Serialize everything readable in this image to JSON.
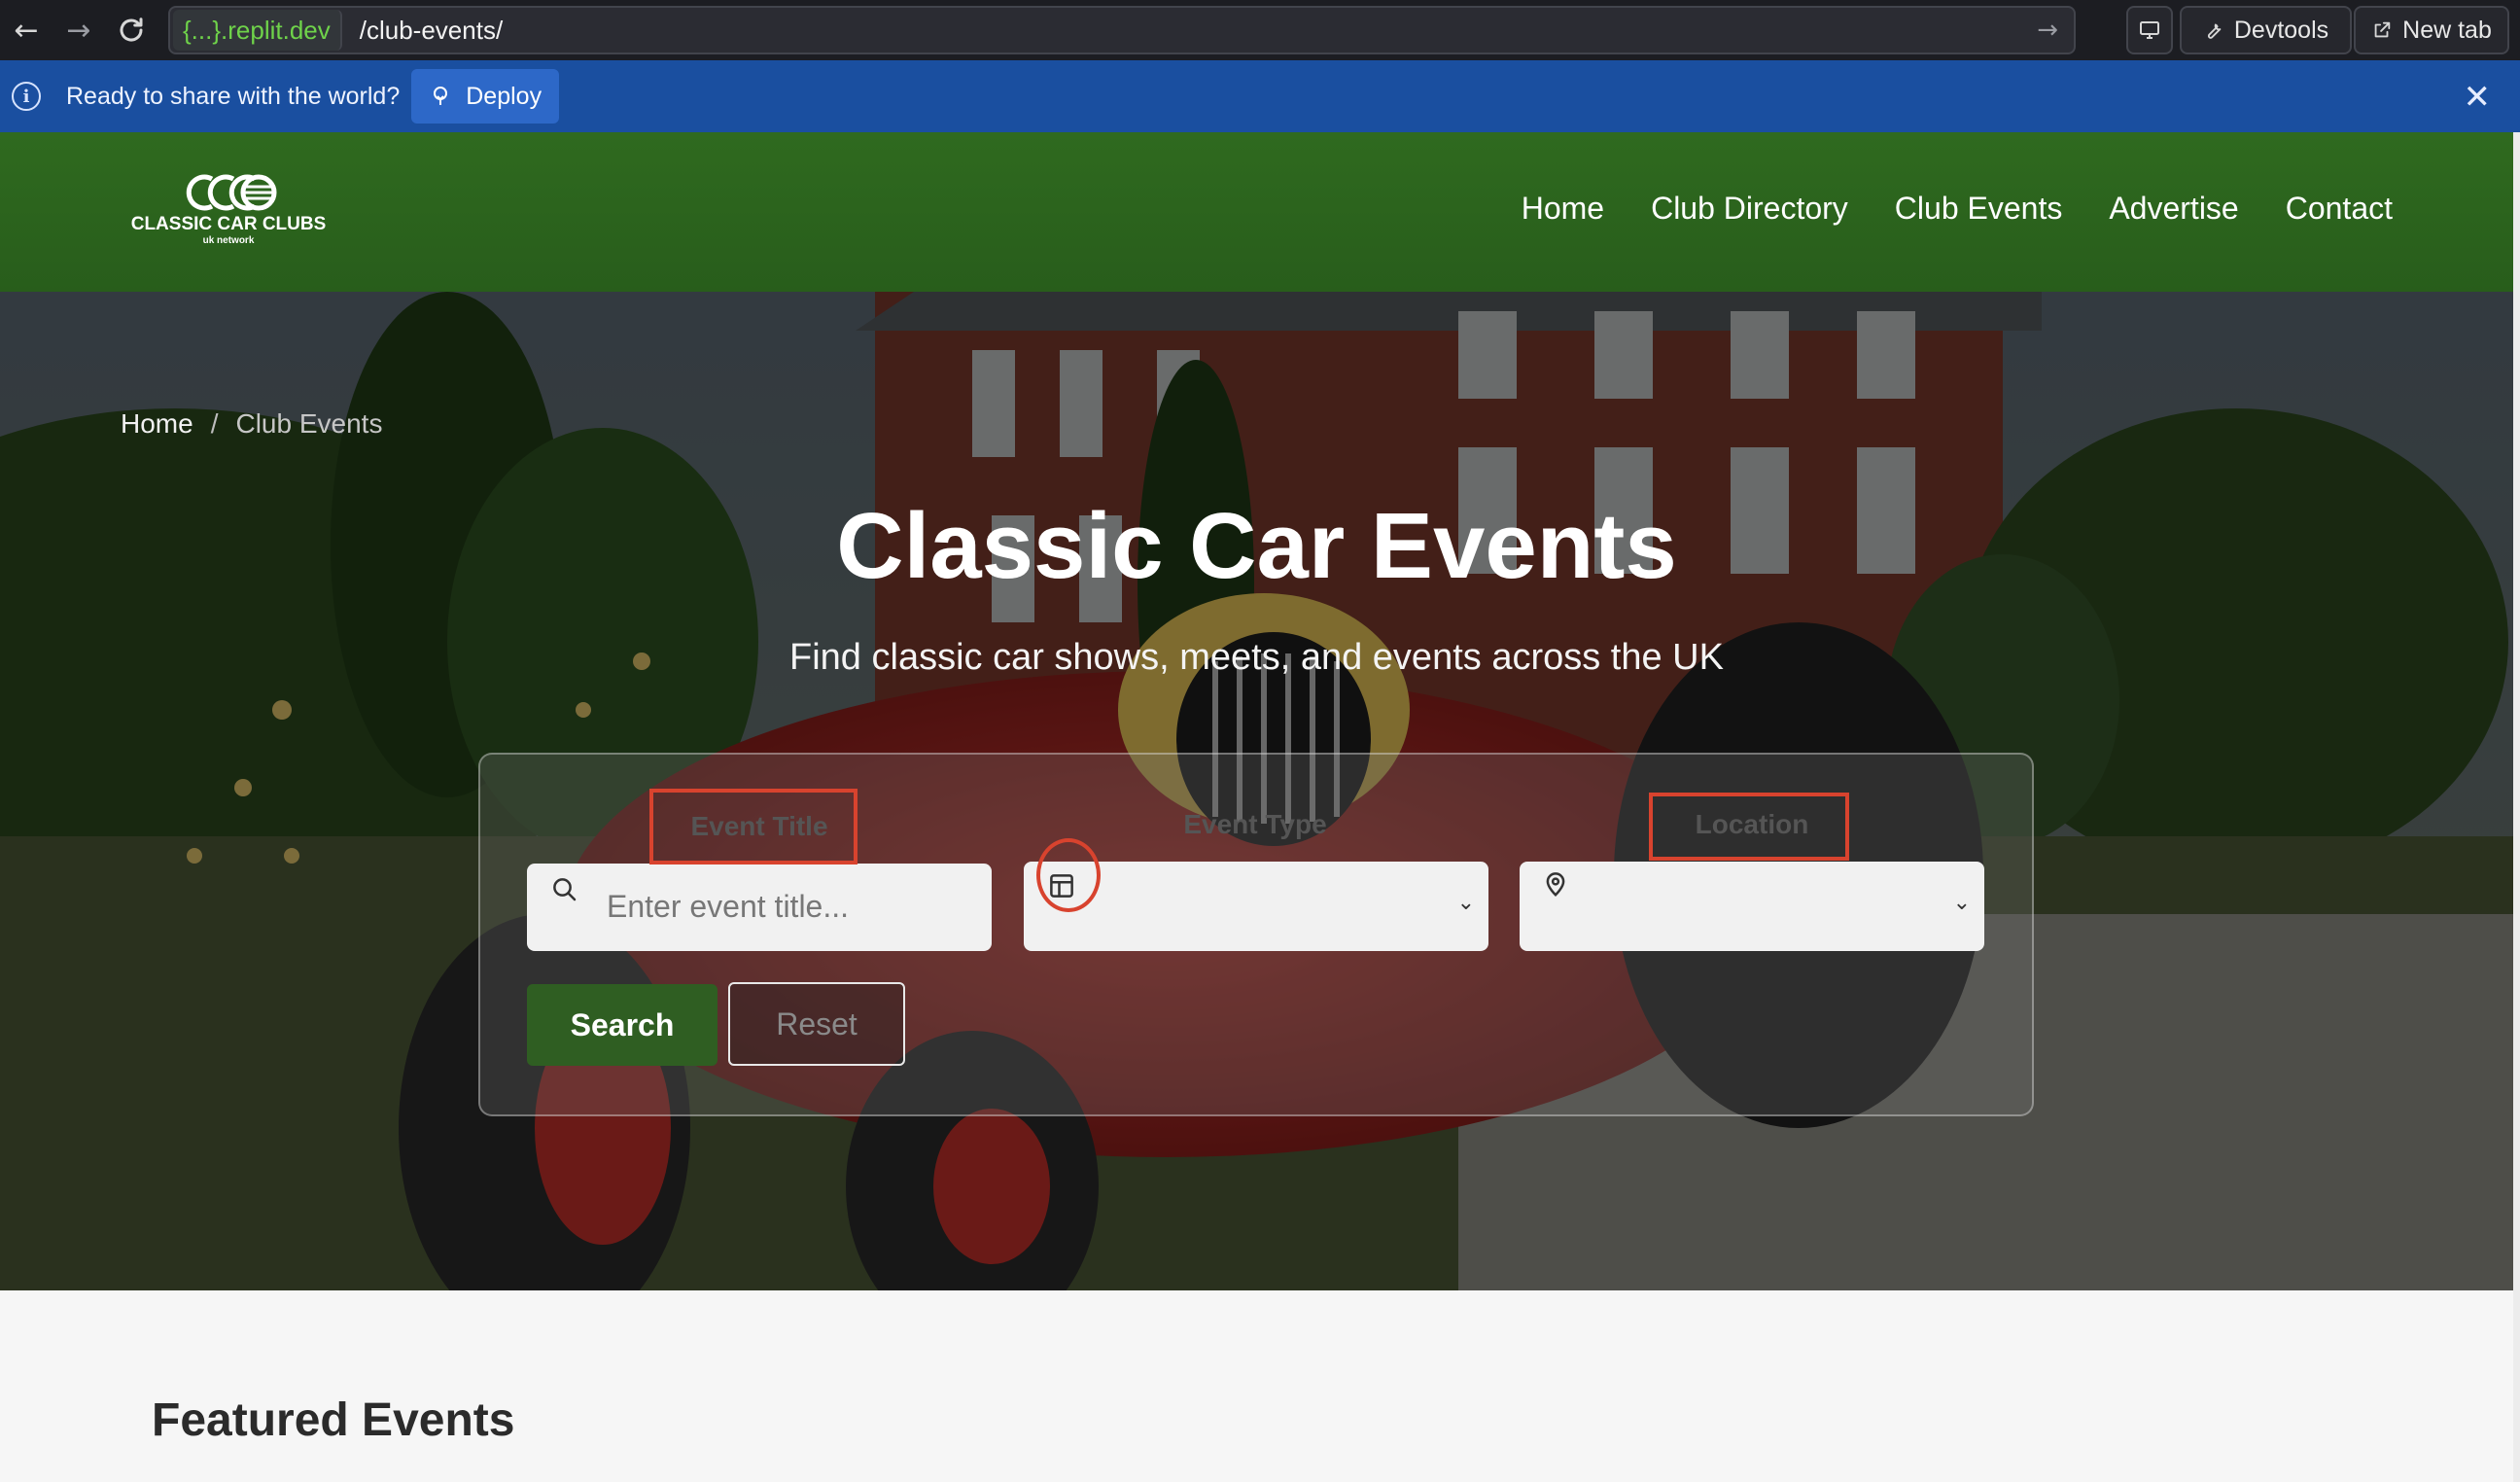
{
  "browser": {
    "back_icon": "arrow-left-icon",
    "forward_icon": "arrow-right-icon",
    "reload_icon": "reload-icon",
    "url_host": "{...}.replit.dev",
    "url_path": "/club-events/",
    "devtools_label": "Devtools",
    "newtab_label": "New tab"
  },
  "banner": {
    "message": "Ready to share with the world?",
    "deploy_label": "Deploy"
  },
  "header": {
    "logo_title": "CLASSIC CAR CLUBS",
    "logo_subtitle": "uk network",
    "nav": [
      "Home",
      "Club Directory",
      "Club Events",
      "Advertise",
      "Contact"
    ]
  },
  "hero": {
    "breadcrumb_home": "Home",
    "breadcrumb_sep": "/",
    "breadcrumb_current": "Club Events",
    "title": "Classic Car Events",
    "subtitle": "Find classic car shows, meets, and events across the UK"
  },
  "search": {
    "event_title_label": "Event Title",
    "event_title_placeholder": "Enter event title...",
    "event_type_label": "Event Type",
    "location_label": "Location",
    "search_label": "Search",
    "reset_label": "Reset"
  },
  "featured": {
    "title": "Featured Events"
  },
  "colors": {
    "header_green": "#2f6a1f",
    "banner_blue": "#1a4fa0",
    "search_button": "#2f5e22",
    "annotation_red": "#d8432e"
  }
}
